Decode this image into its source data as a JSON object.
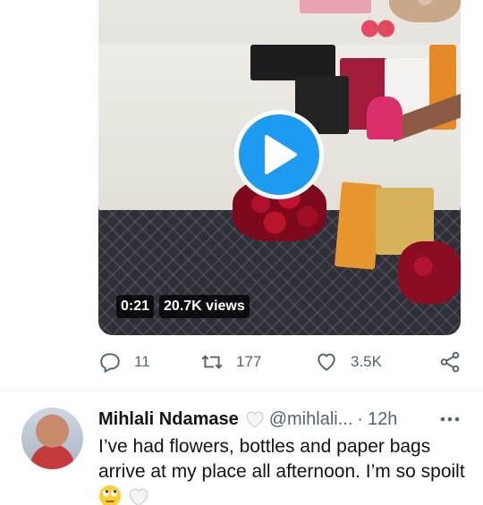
{
  "video": {
    "duration": "0:21",
    "views": "20.7K views"
  },
  "actions": {
    "reply_count": "11",
    "retweet_count": "177",
    "like_count": "3.5K"
  },
  "tweet": {
    "display_name": "Mihlali Ndamase",
    "handle": "@mihlali...",
    "separator": "·",
    "time": "12h",
    "text": "I’ve had flowers, bottles and paper bags arrive at my place all afternoon. I’m so spoilt"
  },
  "icons": {
    "play": "play-icon",
    "reply": "reply-icon",
    "retweet": "retweet-icon",
    "like": "heart-icon",
    "share": "share-icon",
    "more": "more-icon",
    "emoji_heart": "white-heart-emoji",
    "emoji_face": "rolling-eyes-emoji"
  },
  "colors": {
    "accent": "#1d9bf0",
    "secondary_text": "#536471",
    "primary_text": "#0f1419"
  }
}
